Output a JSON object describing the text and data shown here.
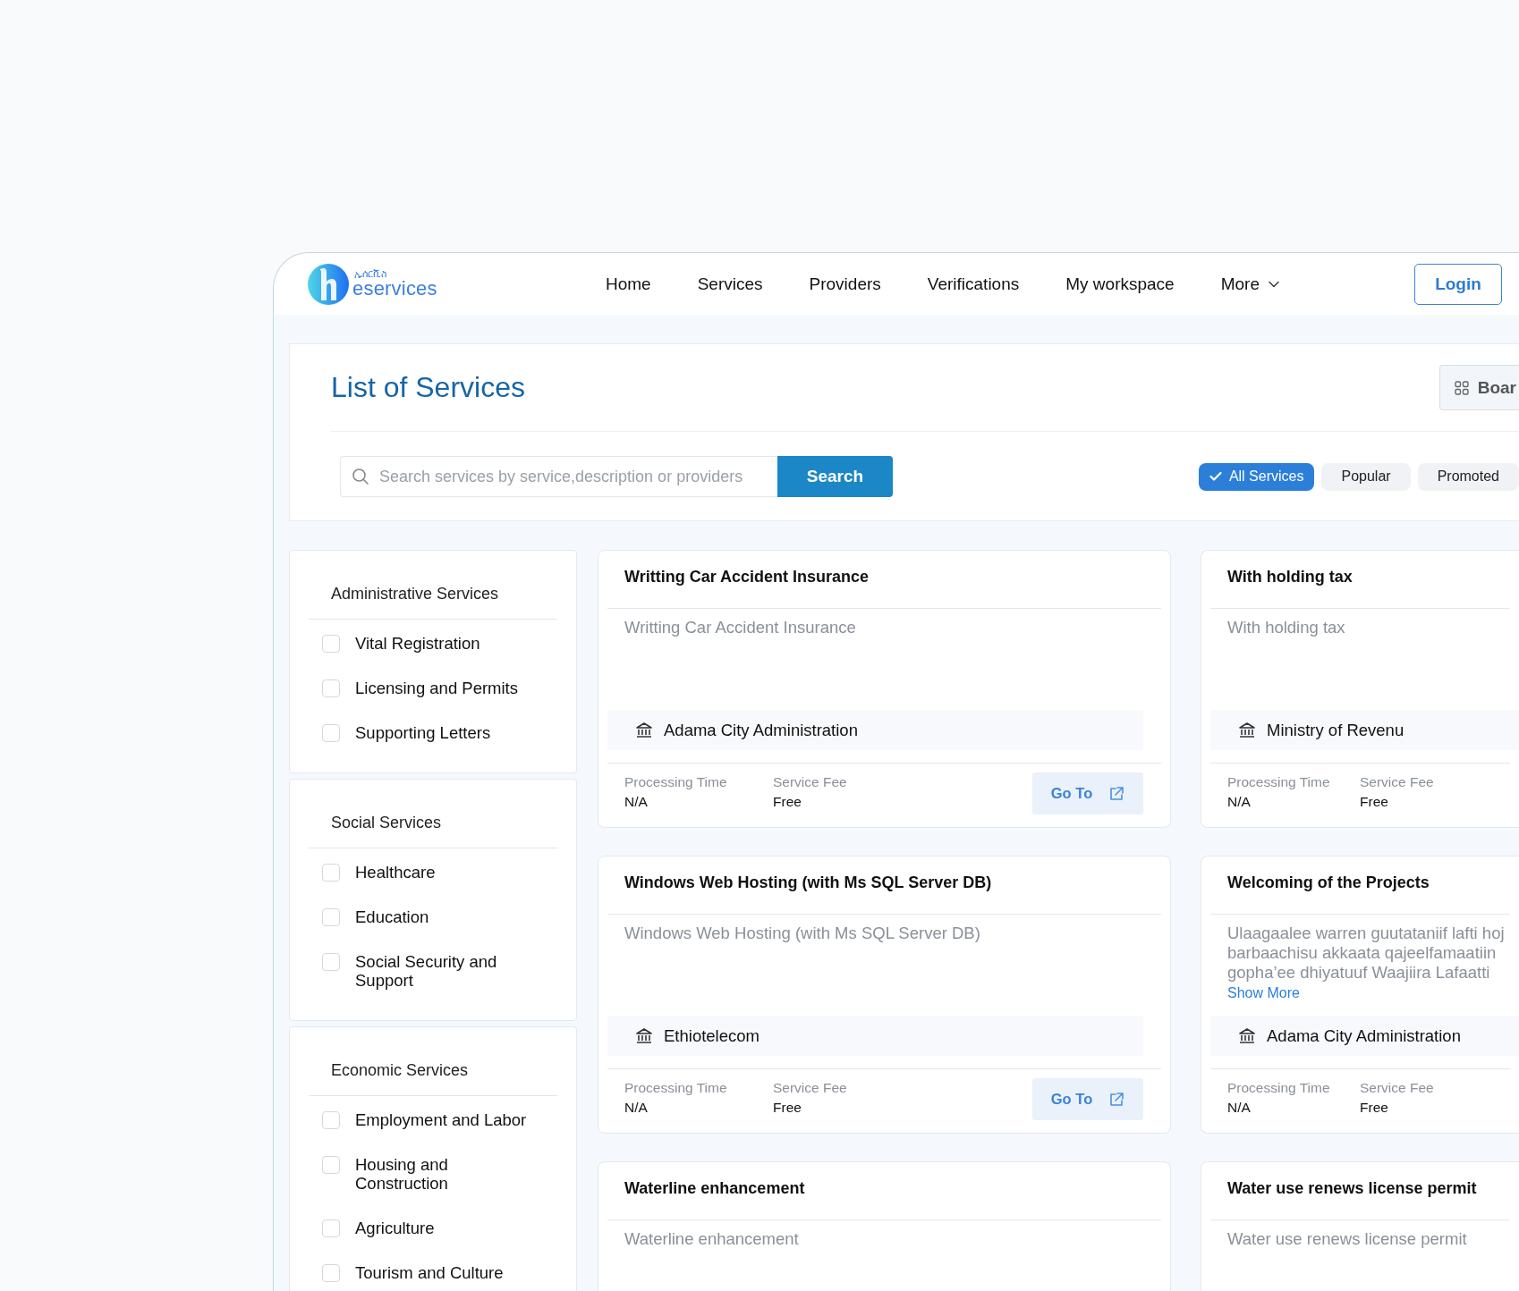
{
  "header": {
    "logo": {
      "script": "ኢሰርቪስ",
      "name": "eservices"
    },
    "nav": [
      {
        "label": "Home",
        "kind": "link"
      },
      {
        "label": "Services",
        "kind": "link"
      },
      {
        "label": "Providers",
        "kind": "link"
      },
      {
        "label": "Verifications",
        "kind": "link"
      },
      {
        "label": "My workspace",
        "kind": "link"
      },
      {
        "label": "More",
        "kind": "dropdown"
      }
    ],
    "login": "Login"
  },
  "page": {
    "title": "List of Services",
    "view_button": "Boar",
    "search": {
      "placeholder": "Search services by service,description or providers",
      "button": "Search"
    },
    "filters": [
      {
        "label": "All Services",
        "selected": true
      },
      {
        "label": "Popular",
        "selected": false
      },
      {
        "label": "Promoted",
        "selected": false
      }
    ]
  },
  "sidebar": [
    {
      "heading": "Administrative Services",
      "items": [
        {
          "label": "Vital Registration",
          "checked": false
        },
        {
          "label": "Licensing and Permits",
          "checked": false
        },
        {
          "label": "Supporting Letters",
          "checked": false
        }
      ]
    },
    {
      "heading": "Social Services",
      "items": [
        {
          "label": "Healthcare",
          "checked": false
        },
        {
          "label": "Education",
          "checked": false
        },
        {
          "label": "Social Security and Support",
          "checked": false
        }
      ]
    },
    {
      "heading": "Economic Services",
      "items": [
        {
          "label": "Employment and Labor",
          "checked": false
        },
        {
          "label": "Housing and Construction",
          "checked": false
        },
        {
          "label": "Agriculture",
          "checked": false
        },
        {
          "label": "Tourism and Culture",
          "checked": false
        }
      ]
    }
  ],
  "services": [
    {
      "title": "Writting Car Accident Insurance",
      "description": "Writting Car Accident Insurance",
      "provider": "Adama City Administration",
      "processing_label": "Processing Time",
      "processing": "N/A",
      "fee_label": "Service Fee",
      "fee": "Free",
      "goto": "Go To"
    },
    {
      "title": "With holding tax",
      "description": "With holding tax",
      "provider": "Ministry of Revenu",
      "processing_label": "Processing Time",
      "processing": "N/A",
      "fee_label": "Service Fee",
      "fee": "Free"
    },
    {
      "title": "Windows Web Hosting (with Ms SQL Server DB)",
      "description": "Windows Web Hosting (with Ms SQL Server DB)",
      "provider": "Ethiotelecom",
      "processing_label": "Processing Time",
      "processing": "N/A",
      "fee_label": "Service Fee",
      "fee": "Free",
      "goto": "Go To"
    },
    {
      "title": "Welcoming of the Projects",
      "description_lines": [
        "Ulaagaalee warren guutataniif lafti hoj",
        "barbaachisu akkaata qajeelfamaatiin",
        "gopha’ee dhiyatuuf Waajiira Lafaatti"
      ],
      "show_more": "Show More",
      "provider": "Adama City Administration",
      "processing_label": "Processing Time",
      "processing": "N/A",
      "fee_label": "Service Fee",
      "fee": "Free"
    },
    {
      "title": "Waterline enhancement",
      "description": "Waterline enhancement"
    },
    {
      "title": "Water use renews license permit",
      "description": "Water use renews license permit"
    }
  ]
}
